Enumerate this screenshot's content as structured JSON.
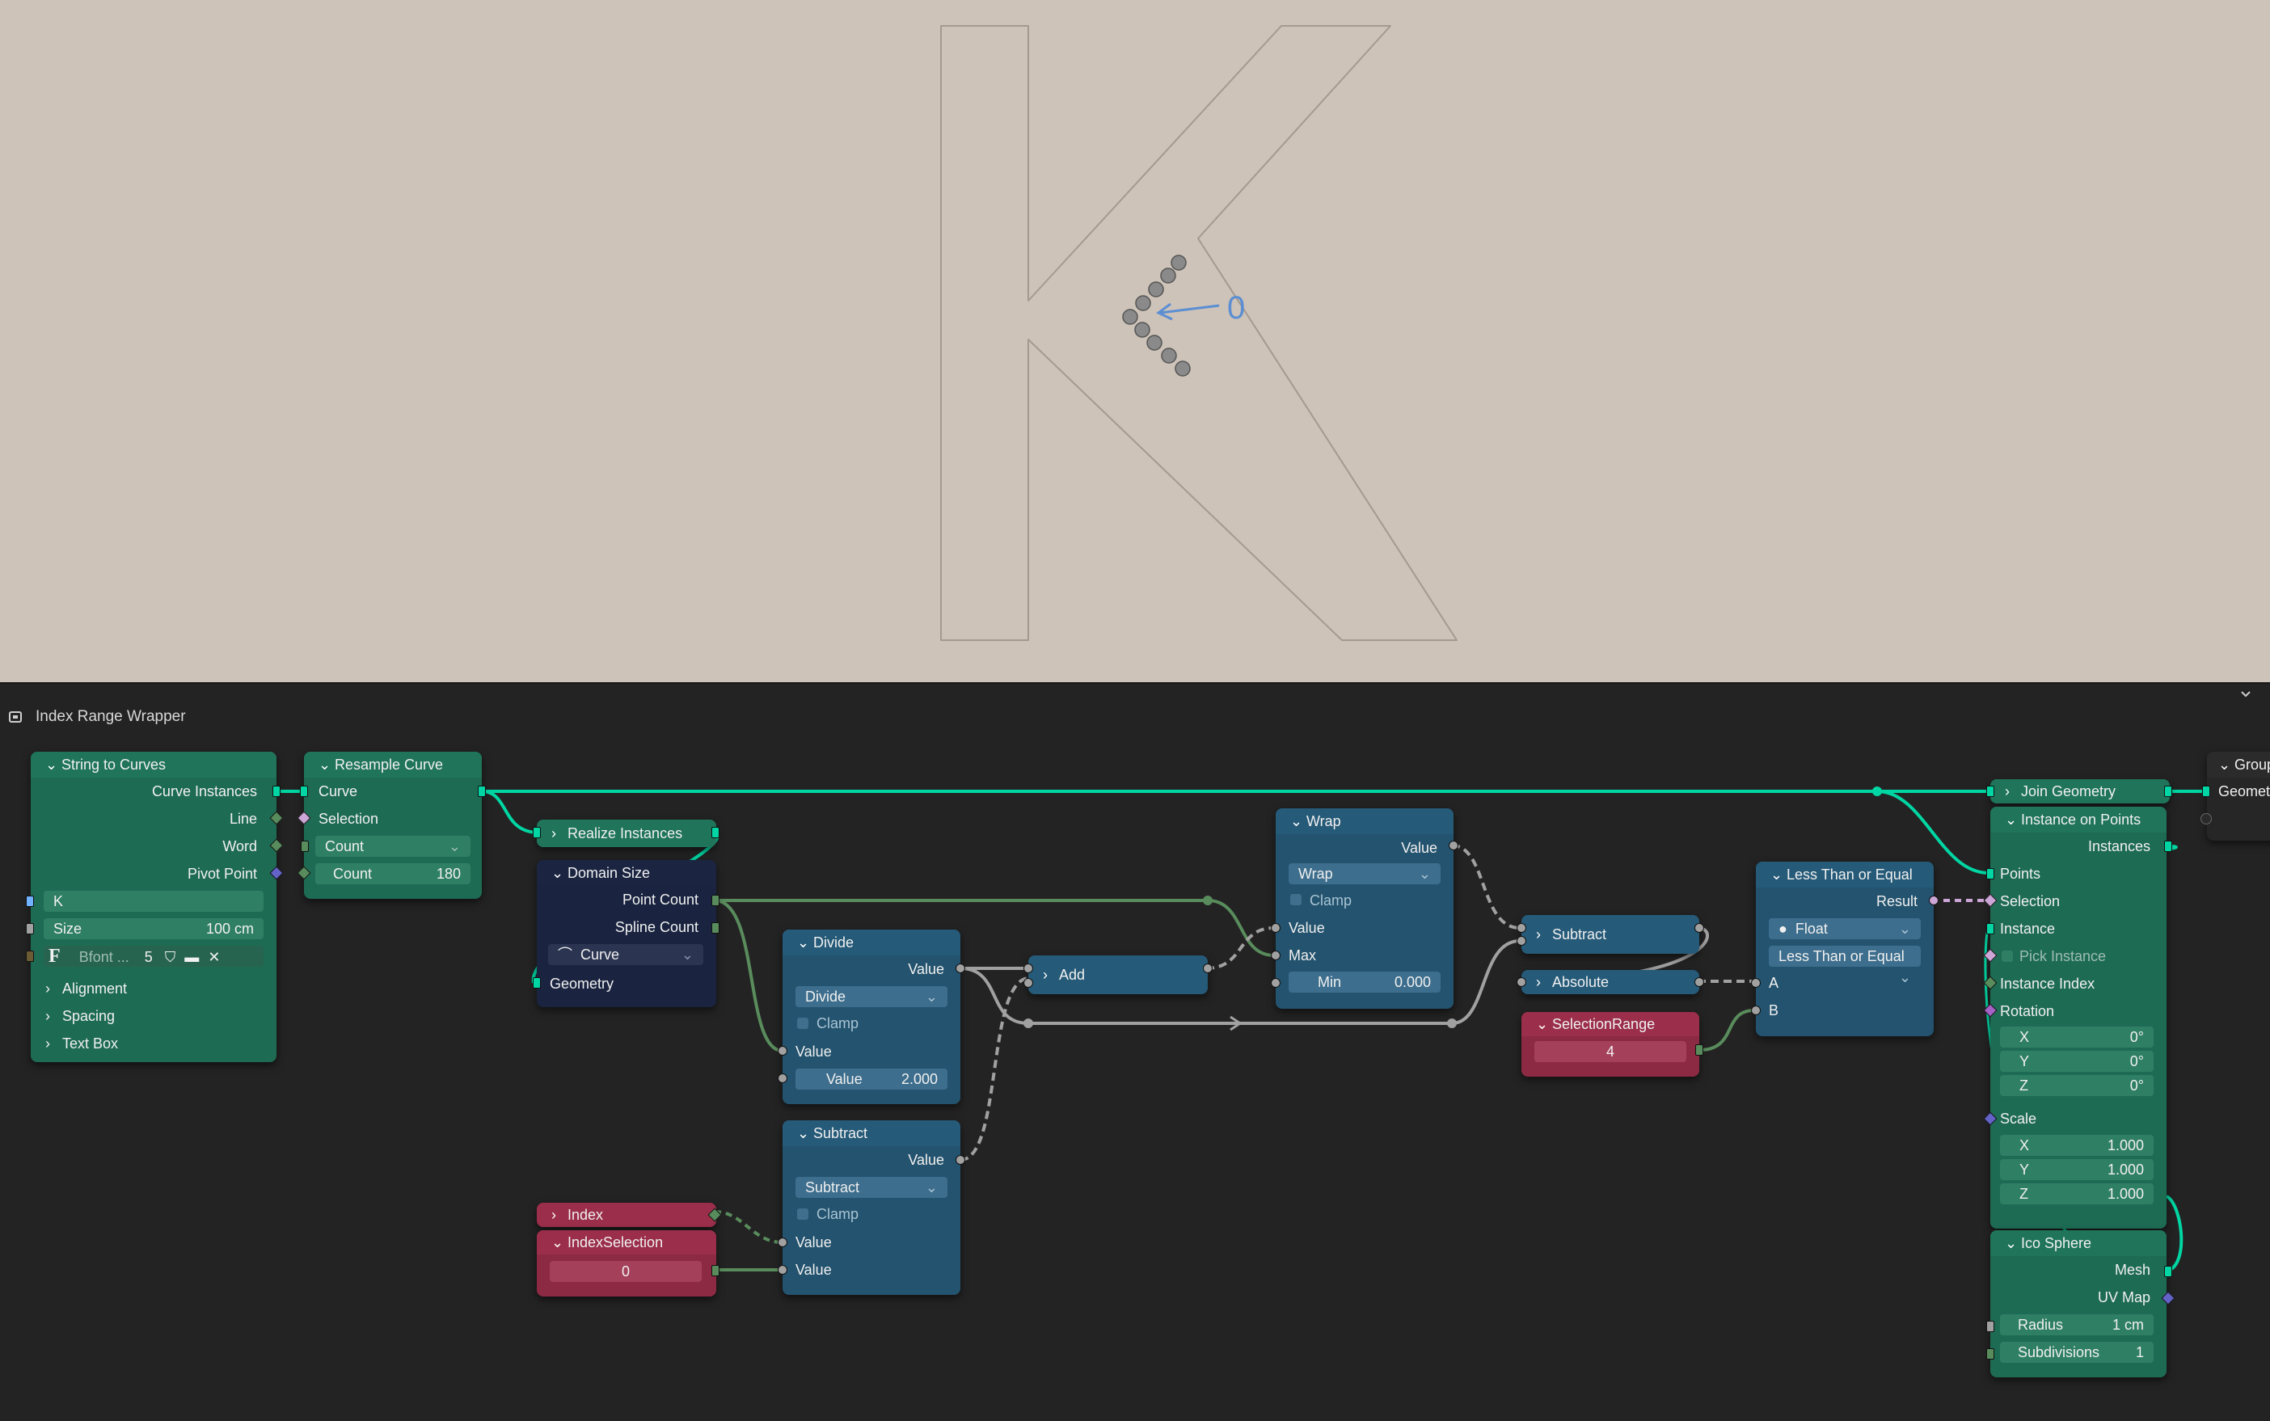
{
  "editor": {
    "title": "Index Range Wrapper"
  },
  "viewport": {
    "letter": "K",
    "annotation": "0"
  },
  "nodes": {
    "string_to_curves": {
      "title": "String to Curves",
      "outputs": [
        "Curve Instances",
        "Line",
        "Word",
        "Pivot Point"
      ],
      "string_value": "K",
      "size_label": "Size",
      "size_value": "100 cm",
      "font_name": "Bfont ...",
      "font_users": "5",
      "panels": [
        "Alignment",
        "Spacing",
        "Text Box"
      ]
    },
    "resample_curve": {
      "title": "Resample Curve",
      "curve": "Curve",
      "selection": "Selection",
      "mode": "Count",
      "count_label": "Count",
      "count_value": "180"
    },
    "realize_instances": {
      "title": "Realize Instances"
    },
    "domain_size": {
      "title": "Domain Size",
      "outputs": [
        "Point Count",
        "Spline Count"
      ],
      "domain": "Curve",
      "geometry": "Geometry"
    },
    "divide": {
      "title": "Divide",
      "output": "Value",
      "op": "Divide",
      "clamp": "Clamp",
      "in1": "Value",
      "in2_label": "Value",
      "in2_value": "2.000"
    },
    "add": {
      "title": "Add"
    },
    "subtract_low": {
      "title": "Subtract",
      "output": "Value",
      "op": "Subtract",
      "clamp": "Clamp",
      "in1": "Value",
      "in2": "Value"
    },
    "index": {
      "title": "Index"
    },
    "index_selection": {
      "title": "IndexSelection",
      "value": "0"
    },
    "wrap": {
      "title": "Wrap",
      "output": "Value",
      "op": "Wrap",
      "clamp": "Clamp",
      "in1": "Value",
      "in2": "Max",
      "min_label": "Min",
      "min_value": "0.000"
    },
    "subtract_top": {
      "title": "Subtract"
    },
    "absolute": {
      "title": "Absolute"
    },
    "selection_range": {
      "title": "SelectionRange",
      "value": "4"
    },
    "less_equal": {
      "title": "Less Than or Equal",
      "output": "Result",
      "dtype": "Float",
      "op": "Less Than or Equal",
      "a": "A",
      "b": "B"
    },
    "join_geometry": {
      "title": "Join Geometry"
    },
    "instance_on_points": {
      "title": "Instance on Points",
      "output": "Instances",
      "inputs": [
        "Points",
        "Selection",
        "Instance"
      ],
      "pick": "Pick Instance",
      "instance_index": "Instance Index",
      "rotation": "Rotation",
      "rot_x": "0°",
      "rot_y": "0°",
      "rot_z": "0°",
      "scale": "Scale",
      "scale_x": "1.000",
      "scale_y": "1.000",
      "scale_z": "1.000",
      "axis_x": "X",
      "axis_y": "Y",
      "axis_z": "Z"
    },
    "ico_sphere": {
      "title": "Ico Sphere",
      "outputs": [
        "Mesh",
        "UV Map"
      ],
      "radius_label": "Radius",
      "radius_value": "1 cm",
      "subdiv_label": "Subdivisions",
      "subdiv_value": "1"
    },
    "group_output": {
      "title": "Group",
      "input": "Geometr"
    }
  },
  "colors": {
    "geometry_wire": "#00d6a3",
    "float_wire": "#a1a1a1",
    "int_wire": "#598c5c",
    "viewport_bg": "#cdc3b8",
    "editor_bg": "#232323"
  }
}
